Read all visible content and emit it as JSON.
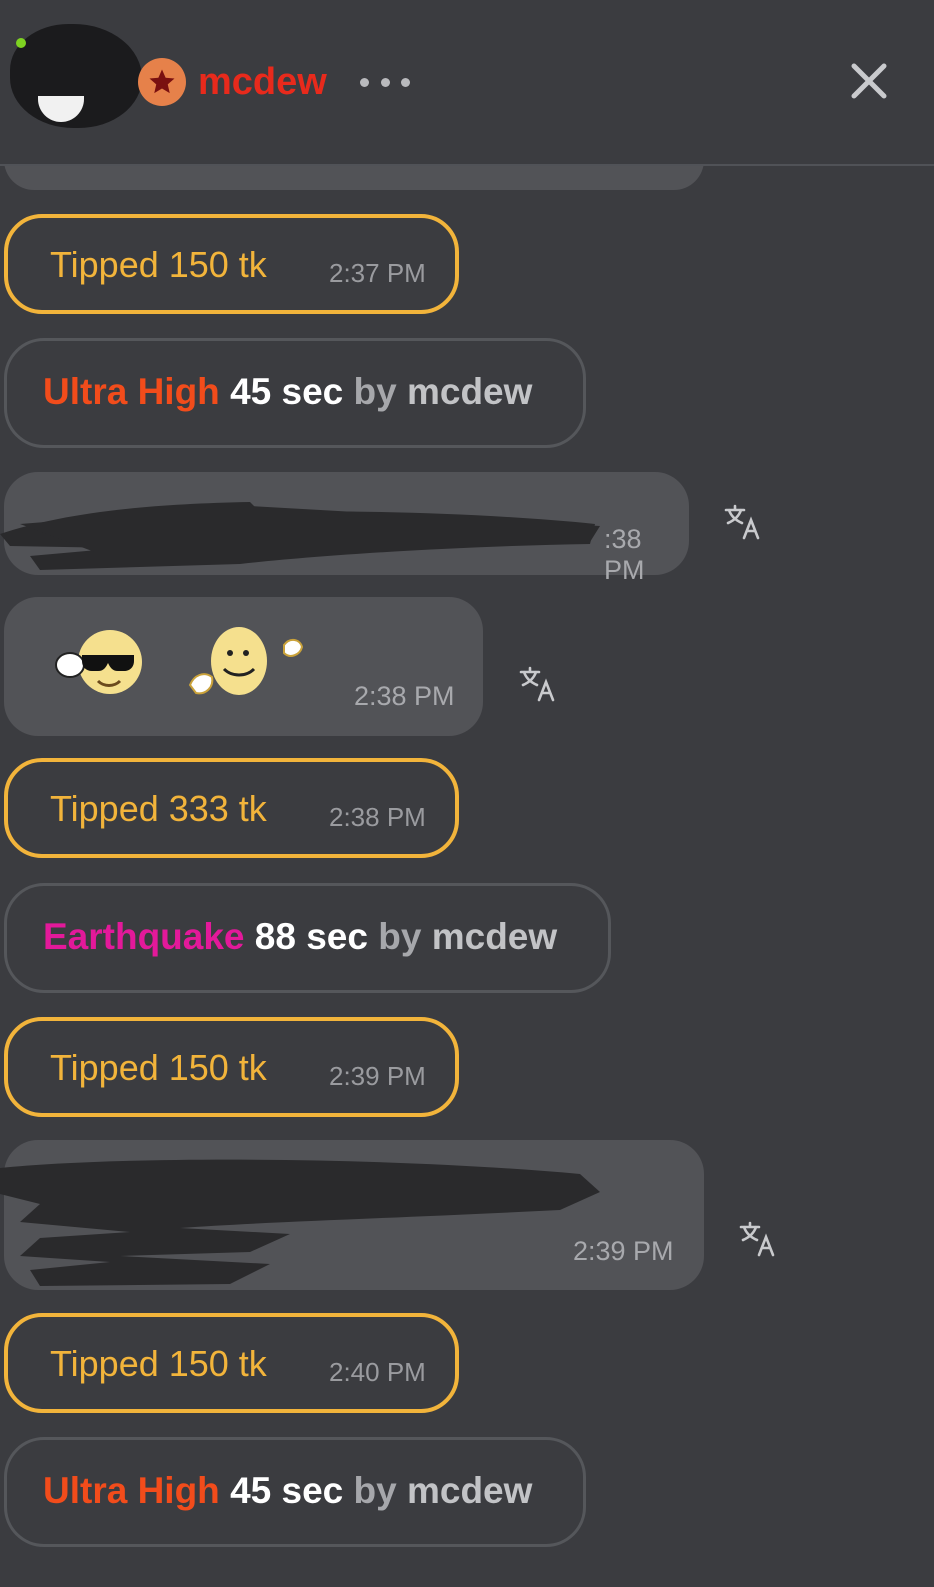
{
  "header": {
    "username": "mcdew",
    "more_icon": "more-horizontal-icon",
    "close_icon": "close-icon",
    "rank_icon": "star-badge-icon",
    "online_status": "online"
  },
  "colors": {
    "tip_accent": "#f2b43b",
    "ultra_high": "#f24c1b",
    "earthquake": "#e3199a",
    "username": "#e82a1c",
    "background": "#3b3c40",
    "bubble": "#525357"
  },
  "messages": [
    {
      "type": "tip",
      "label": "Tipped 150 tk",
      "time": "2:37 PM"
    },
    {
      "type": "lovense",
      "level": "Ultra High",
      "duration": "45 sec",
      "by": "by",
      "user": "mcdew"
    },
    {
      "type": "chat",
      "text_redacted": true,
      "time": ":38 PM",
      "translate_icon": "translate-icon"
    },
    {
      "type": "chat",
      "emojis": [
        "cool-sunglasses-emoji-icon",
        "waving-smile-emoji-icon"
      ],
      "time": "2:38 PM",
      "translate_icon": "translate-icon"
    },
    {
      "type": "tip",
      "label": "Tipped 333 tk",
      "time": "2:38 PM"
    },
    {
      "type": "lovense",
      "level": "Earthquake",
      "duration": "88 sec",
      "by": "by",
      "user": "mcdew"
    },
    {
      "type": "tip",
      "label": "Tipped 150 tk",
      "time": "2:39 PM"
    },
    {
      "type": "chat",
      "text_redacted": true,
      "time": "2:39 PM",
      "translate_icon": "translate-icon"
    },
    {
      "type": "tip",
      "label": "Tipped 150 tk",
      "time": "2:40 PM"
    },
    {
      "type": "lovense",
      "level": "Ultra High",
      "duration": "45 sec",
      "by": "by",
      "user": "mcdew"
    }
  ]
}
